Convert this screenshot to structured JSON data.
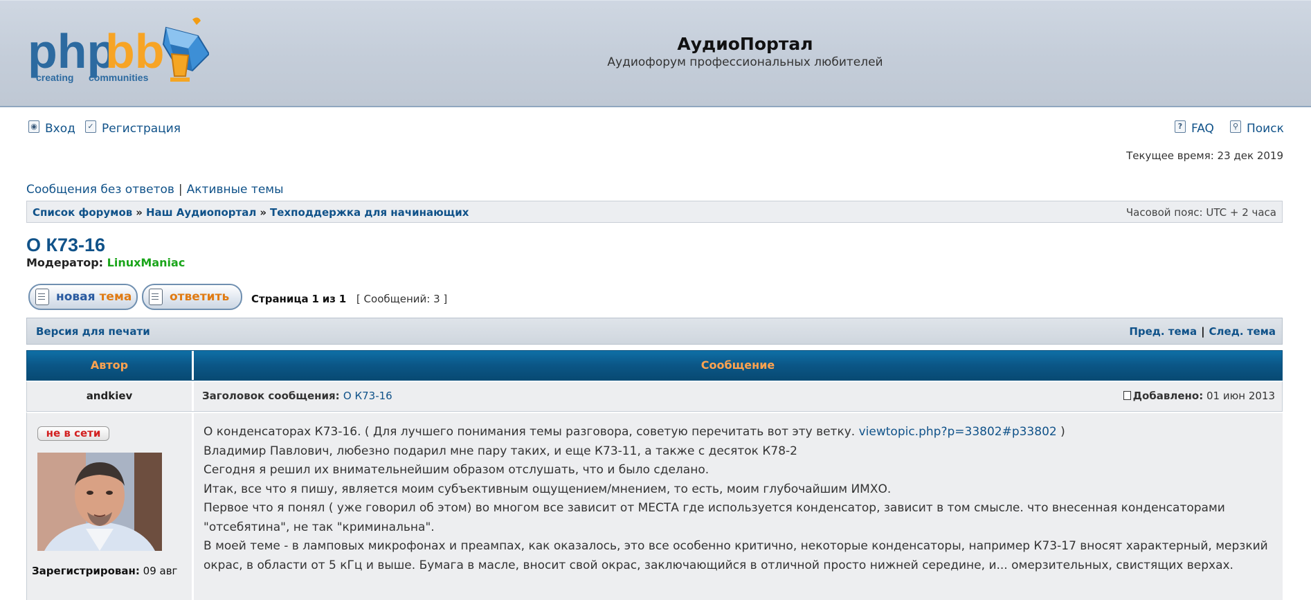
{
  "header": {
    "site_title": "АудиоПортал",
    "site_description": "Аудиофорум профессиональных любителей",
    "logo": {
      "icon": "phpbb-logo",
      "word": "phpbb",
      "tagline": "creating communities"
    }
  },
  "nav": {
    "login": "Вход",
    "register": "Регистрация",
    "faq": "FAQ",
    "search": "Поиск",
    "icons": [
      "login-icon",
      "register-icon",
      "faq-icon",
      "search-icon"
    ]
  },
  "time_text": "Текущее время: 23 дек 2019",
  "quick_links": {
    "unanswered": "Сообщения без ответов",
    "separator": "|",
    "active": "Активные темы"
  },
  "breadcrumb": {
    "items": [
      "Список форумов",
      "Наш Аудиопортал",
      "Техподдержка для начинающих"
    ],
    "separator": "»",
    "timezone": "Часовой пояс: UTC + 2 часа"
  },
  "topic": {
    "title": "О К73-16",
    "moderator_label": "Модератор:",
    "moderator_name": "LinuxManiac"
  },
  "buttons": {
    "new_topic_1": "новая",
    "new_topic_2": "тема",
    "reply": "ответить"
  },
  "pagination": {
    "page_label": "Страница",
    "current": "1",
    "of_label": "из",
    "total": "1",
    "posts_count": "[ Сообщений: 3 ]"
  },
  "actions": {
    "print": "Версия для печати",
    "prev": "Пред. тема",
    "separator": "|",
    "next": "След. тема"
  },
  "table_head": {
    "author": "Автор",
    "message": "Сообщение"
  },
  "post": {
    "author": "andkiev",
    "subject_label": "Заголовок сообщения:",
    "subject": "О К73-16",
    "posted_label": "Добавлено:",
    "posted_date": "01 июн 2013",
    "status": "не в сети",
    "registered_label": "Зарегистрирован:",
    "registered_value": "09 авг",
    "body": {
      "line1_pre": "О конденсаторах К73-16. ( Для лучшего понимания темы разговора, советую перечитать вот эту ветку.",
      "line1_link": "viewtopic.php?p=33802#p33802",
      "line1_post": ")",
      "line2": "Владимир Павлович, любезно подарил мне пару таких, и еще К73-11, а также с десяток К78-2",
      "line3": "Сегодня я решил их внимательнейшим образом отслушать, что и было сделано.",
      "line4": "Итак, все что я пишу, является моим субъективным ощущением/мнением, то есть, моим глубочайшим ИМХО.",
      "line5": "Первое что я понял ( уже говорил об этом) во многом все зависит от МЕСТА где используется конденсатор, зависит в том смысле. что внесенная конденсаторами \"отсебятина\", не так \"криминальна\".",
      "line6": "В моей теме - в ламповых микрофонах и преампах, как оказалось, это все особенно критично, некоторые конденсаторы, например К73-17 вносят характерный, мерзкий окрас, в области от 5 кГц и выше. Бумага в масле, вносит свой окрас, заключающийся в отличной просто нижней середине, и... омерзительных, свистящих верхах."
    }
  },
  "colors": {
    "link": "#105289",
    "header_bg": "#c4cdd9",
    "table_head_bg": "#0b5686",
    "table_head_text": "#ffa34f",
    "moderator": "#1aa51a",
    "offline": "#d21f1f"
  }
}
